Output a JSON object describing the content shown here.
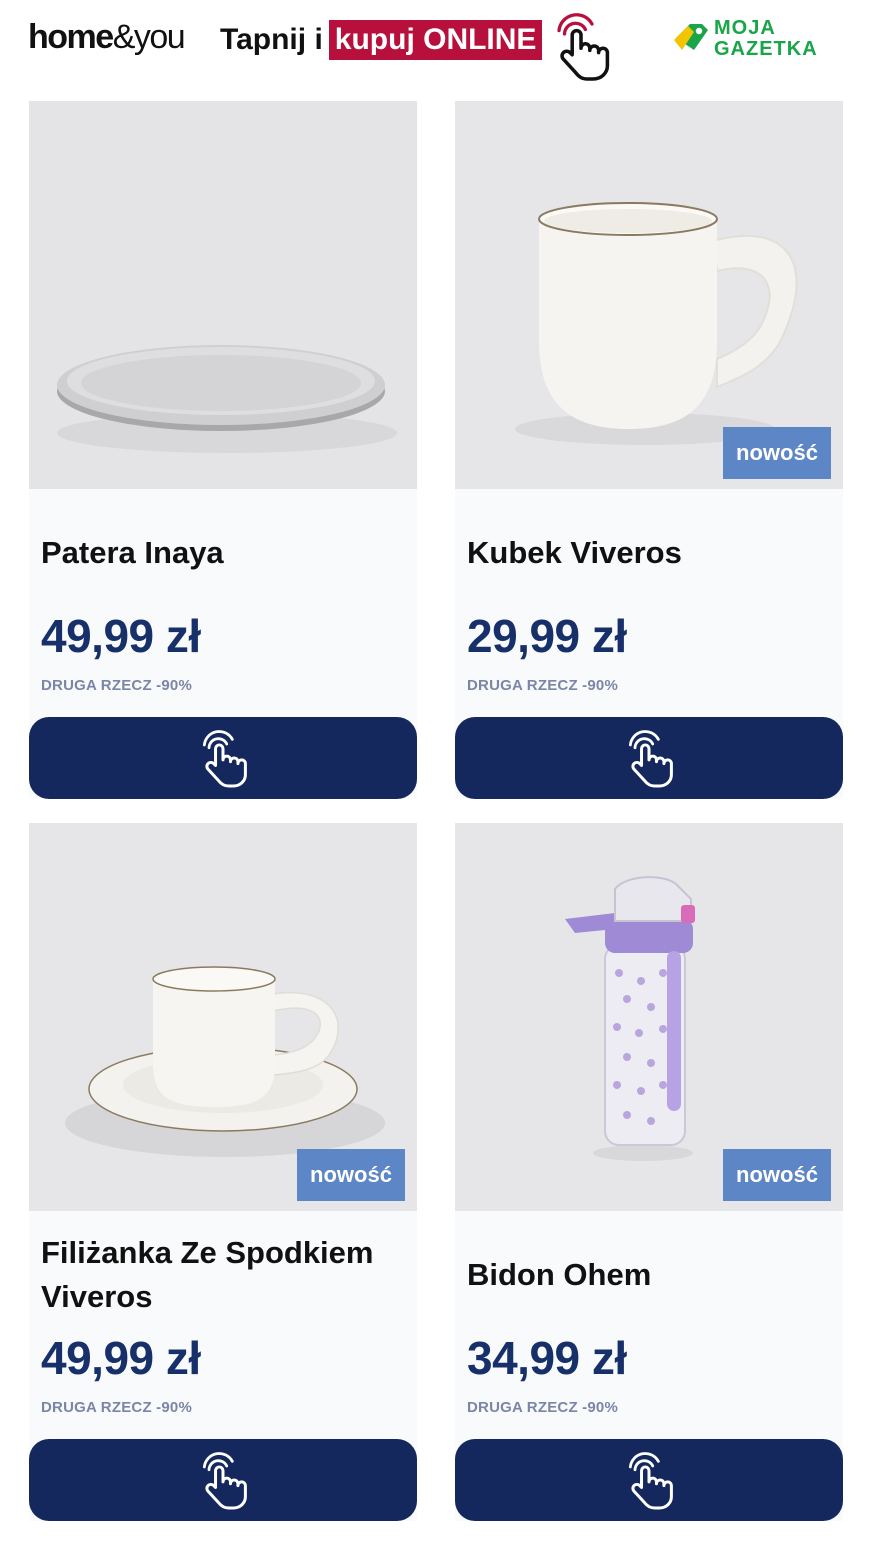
{
  "header": {
    "brand_home": "home",
    "brand_rest": "&you",
    "tagline_plain": "Tapnij i",
    "tagline_highlight": "kupuj ONLINE",
    "moja_line1": "MOJA",
    "moja_line2": "GAZETKA",
    "colors": {
      "highlight": "#b8103c",
      "moja": "#1aa54a"
    }
  },
  "colors": {
    "price": "#17306a",
    "button": "#14285e",
    "badge": "#5d86c6",
    "promo": "#7b86a6"
  },
  "products": [
    {
      "name": "Patera Inaya",
      "price": "49,99 zł",
      "promo": "DRUGA RZECZ -90%",
      "badge": "",
      "image": "plate",
      "button_icon": "tap-hand-icon"
    },
    {
      "name": "Kubek Viveros",
      "price": "29,99 zł",
      "promo": "DRUGA RZECZ -90%",
      "badge": "nowość",
      "image": "mug",
      "button_icon": "tap-hand-icon"
    },
    {
      "name": "Filiżanka Ze Spodkiem Viveros",
      "price": "49,99 zł",
      "promo": "DRUGA RZECZ -90%",
      "badge": "nowość",
      "image": "cup-with-saucer",
      "button_icon": "tap-hand-icon"
    },
    {
      "name": "Bidon Ohem",
      "price": "34,99 zł",
      "promo": "DRUGA RZECZ -90%",
      "badge": "nowość",
      "image": "water-bottle",
      "button_icon": "tap-hand-icon"
    }
  ]
}
